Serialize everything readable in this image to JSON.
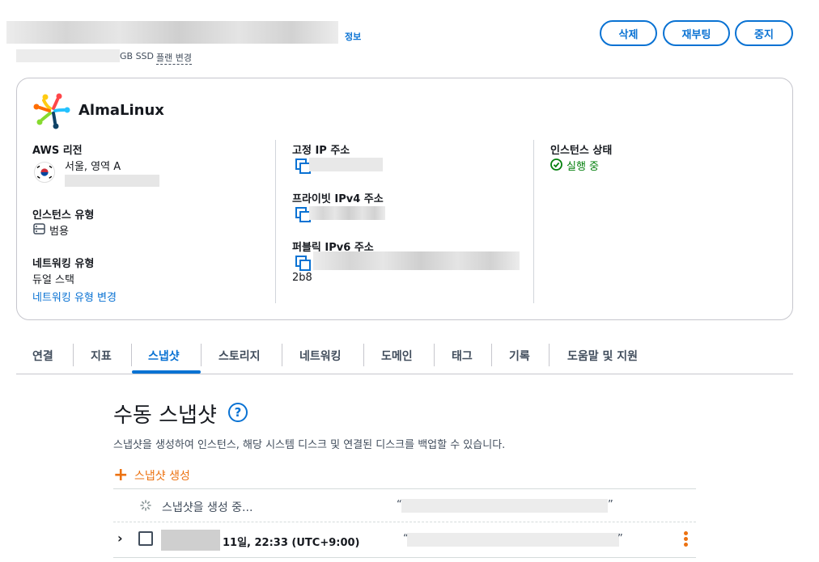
{
  "header": {
    "info_link": "정보",
    "disk_text": "GB SSD",
    "plan_change": "플랜 변경",
    "buttons": {
      "delete": "삭제",
      "reboot": "재부팅",
      "stop": "중지"
    }
  },
  "instance": {
    "os_name": "AlmaLinux",
    "region_label": "AWS 리전",
    "region_value": "서울, 영역 A",
    "instance_type_label": "인스턴스 유형",
    "instance_type_value": "범용",
    "networking_type_label": "네트워킹 유형",
    "networking_type_value": "듀얼 스택",
    "networking_type_change": "네트워킹 유형 변경",
    "static_ip_label": "고정 IP 주소",
    "private_ipv4_label": "프라이빗 IPv4 주소",
    "public_ipv6_label": "퍼블릭 IPv6 주소",
    "public_ipv6_suffix": "2b8",
    "state_label": "인스턴스 상태",
    "state_value": "실행 중",
    "state_color": "#037f0c"
  },
  "tabs": [
    {
      "label": "연결"
    },
    {
      "label": "지표"
    },
    {
      "label": "스냅샷"
    },
    {
      "label": "스토리지"
    },
    {
      "label": "네트워킹"
    },
    {
      "label": "도메인"
    },
    {
      "label": "태그"
    },
    {
      "label": "기록"
    },
    {
      "label": "도움말 및 지원"
    }
  ],
  "active_tab": "스냅샷",
  "snapshots": {
    "title": "수동 스냅샷",
    "help": "?",
    "description": "스냅샷을 생성하여 인스턴스, 해당 시스템 디스크 및 연결된 디스크를 백업할 수 있습니다.",
    "create_label": "스냅샷 생성",
    "creating_text": "스냅샷을 생성 중...",
    "row_date": "11일, 22:33 (UTC+9:00)"
  },
  "colors": {
    "accent": "#0972d3",
    "orange": "#ec7211"
  }
}
